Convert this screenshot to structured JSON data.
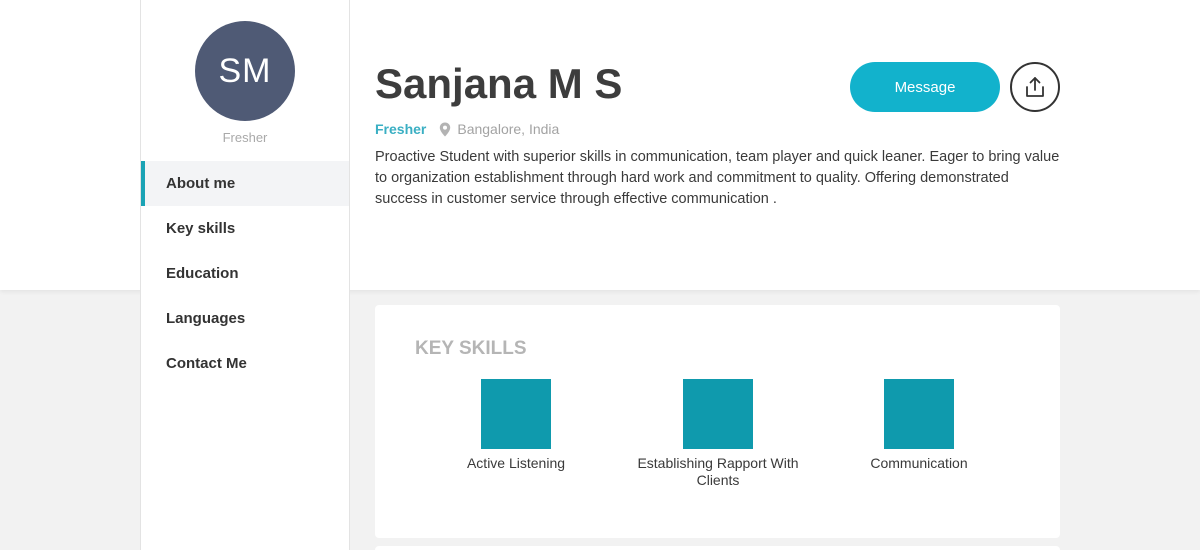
{
  "profile": {
    "initials": "SM",
    "avatar_caption": "Fresher",
    "name": "Sanjana M S",
    "status": "Fresher",
    "location": "Bangalore, India",
    "bio": "Proactive Student with superior skills in communication, team player and quick leaner. Eager to bring value to organization establishment through hard work and commitment to quality. Offering demonstrated success in customer service through effective communication ."
  },
  "nav": {
    "items": [
      {
        "label": "About me",
        "active": true
      },
      {
        "label": "Key skills"
      },
      {
        "label": "Education"
      },
      {
        "label": "Languages"
      },
      {
        "label": "Contact Me"
      }
    ]
  },
  "actions": {
    "message_label": "Message",
    "share_icon": "share-upload-icon"
  },
  "key_skills": {
    "title": "KEY SKILLS",
    "items": [
      {
        "label": "Active Listening"
      },
      {
        "label": "Establishing Rapport With Clients"
      },
      {
        "label": "Communication"
      }
    ]
  },
  "colors": {
    "accent": "#12b2cc",
    "skill_tile": "#0f9aad",
    "avatar_bg": "#4f5a75",
    "status_text": "#3aafc3"
  }
}
